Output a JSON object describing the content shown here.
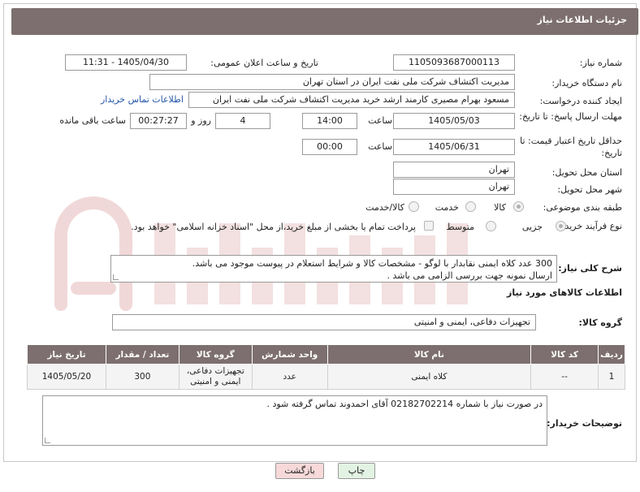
{
  "header": {
    "title": "جزئیات اطلاعات نیاز"
  },
  "form": {
    "need_number_label": "شماره نیاز:",
    "need_number": "1105093687000113",
    "announce_label": "تاریخ و ساعت اعلان عمومی:",
    "announce_value": "1405/04/30 - 11:31",
    "buyer_label": "نام دستگاه خریدار:",
    "buyer_value": "مدیریت اکتشاف شرکت ملی نفت ایران در استان تهران",
    "creator_label": "ایجاد کننده درخواست:",
    "creator_value": "مسعود بهرام مصیری کارمند ارشد خرید مدیریت اکتشاف شرکت ملی نفت ایران",
    "contact_link": "اطلاعات تماس خریدار",
    "deadline_label": "مهلت ارسال پاسخ: تا تاریخ:",
    "deadline_date": "1405/05/03",
    "time_label": "ساعت",
    "deadline_time": "14:00",
    "days_value": "4",
    "days_label": "روز و",
    "remaining_value": "00:27:27",
    "remaining_label": "ساعت باقی مانده",
    "price_label": "حداقل تاریخ اعتبار قیمت: تا تاریخ:",
    "price_date": "1405/06/31",
    "price_time": "00:00",
    "province_label": "استان محل تحویل:",
    "province_value": "تهران",
    "city_label": "شهر محل تحویل:",
    "city_value": "تهران",
    "category_label": "طبقه بندی موضوعی:",
    "category_options": [
      "کالا",
      "خدمت",
      "کالا/خدمت"
    ],
    "category_selected": "کالا",
    "process_label": "نوع فرآیند خرید :",
    "process_options": [
      "جزیی",
      "متوسط"
    ],
    "process_selected": "جزیی",
    "payment_text": "پرداخت تمام یا بخشی از مبلغ خرید،از محل \"اسناد خزانه اسلامی\" خواهد بود."
  },
  "description": {
    "label": "شرح کلی نیاز:",
    "line1": "300 عدد کلاه ایمنی نقابدار با لوگو - مشخصات کالا و شرایط استعلام در پیوست موجود می باشد.",
    "line2": "ارسال نمونه جهت بررسی الزامی می باشد ."
  },
  "goods": {
    "section_title": "اطلاعات کالاهای مورد نیاز",
    "group_label": "گروه کالا:",
    "group_value": "تجهیزات دفاعی، ایمنی و امنیتی"
  },
  "table": {
    "headers": [
      "ردیف",
      "کد کالا",
      "نام کالا",
      "واحد شمارش",
      "گروه کالا",
      "تعداد / مقدار",
      "تاریخ نیاز"
    ],
    "rows": [
      {
        "row": "1",
        "code": "--",
        "name": "کلاه ایمنی",
        "unit": "عدد",
        "group": "تجهیزات دفاعی، ایمنی و امنیتی",
        "qty": "300",
        "date": "1405/05/20"
      }
    ]
  },
  "buyer_notes": {
    "label": "توضیحات خریدار:",
    "text": "در صورت نیاز با شماره 02182702214 آقای احمدوند تماس گرفته شود ."
  },
  "buttons": {
    "print": "چاپ",
    "back": "بازگشت"
  },
  "colors": {
    "header_bg": "#7d6f6f",
    "link": "#2255aa",
    "back_btn": "#f7d9d9",
    "print_btn": "#e3f3e3"
  }
}
